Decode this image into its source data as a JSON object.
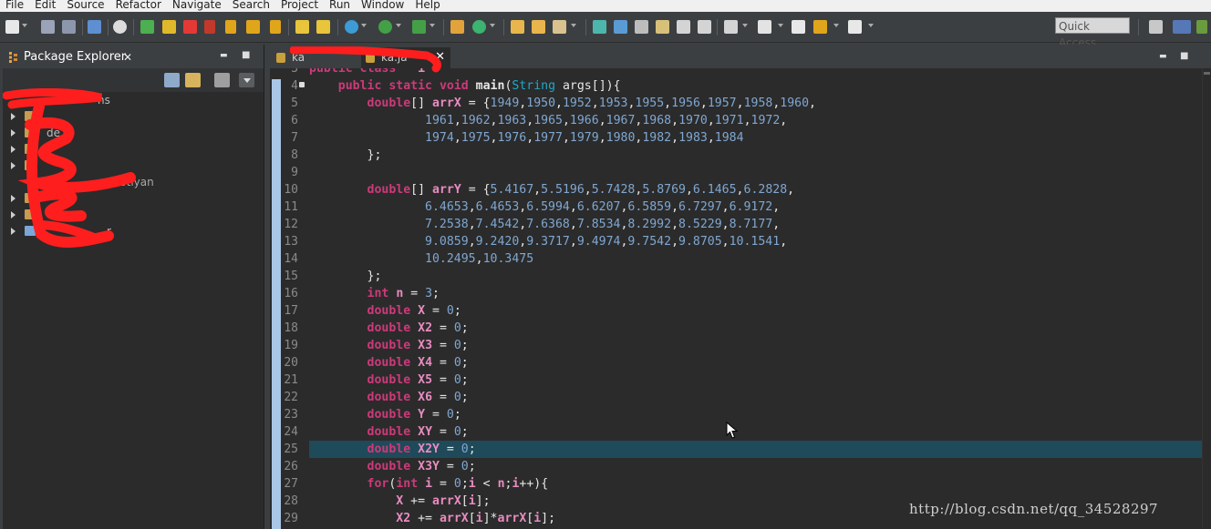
{
  "menu": [
    "File",
    "Edit",
    "Source",
    "Refactor",
    "Navigate",
    "Search",
    "Project",
    "Run",
    "Window",
    "Help"
  ],
  "toolbar": {
    "quick_access": "Quick Access"
  },
  "explorer": {
    "title": "Package Explorer",
    "close": "✕",
    "minimize": "▬",
    "maximize": "■",
    "items": [
      "ns",
      "",
      "de",
      "",
      "",
      "giaotiyan",
      "",
      "rs",
      "r"
    ]
  },
  "editor": {
    "tabs": [
      {
        "label": "ka"
      },
      {
        "label": "ka.ja"
      }
    ],
    "active_close": "✕",
    "lines": [
      {
        "n": "3",
        "text": "public class   i"
      },
      {
        "n": "4",
        "text": "    public static void main(String args[]){"
      },
      {
        "n": "5",
        "text": "        double[] arrX = {1949,1950,1952,1953,1955,1956,1957,1958,1960,"
      },
      {
        "n": "6",
        "text": "                1961,1962,1963,1965,1966,1967,1968,1970,1971,1972,"
      },
      {
        "n": "7",
        "text": "                1974,1975,1976,1977,1979,1980,1982,1983,1984"
      },
      {
        "n": "8",
        "text": "        };"
      },
      {
        "n": "9",
        "text": ""
      },
      {
        "n": "10",
        "text": "        double[] arrY = {5.4167,5.5196,5.7428,5.8769,6.1465,6.2828,"
      },
      {
        "n": "11",
        "text": "                6.4653,6.4653,6.5994,6.6207,6.5859,6.7297,6.9172,"
      },
      {
        "n": "12",
        "text": "                7.2538,7.4542,7.6368,7.8534,8.2992,8.5229,8.7177,"
      },
      {
        "n": "13",
        "text": "                9.0859,9.2420,9.3717,9.4974,9.7542,9.8705,10.1541,"
      },
      {
        "n": "14",
        "text": "                10.2495,10.3475"
      },
      {
        "n": "15",
        "text": "        };"
      },
      {
        "n": "16",
        "text": "        int n = 3;"
      },
      {
        "n": "17",
        "text": "        double X = 0;"
      },
      {
        "n": "18",
        "text": "        double X2 = 0;"
      },
      {
        "n": "19",
        "text": "        double X3 = 0;"
      },
      {
        "n": "20",
        "text": "        double X4 = 0;"
      },
      {
        "n": "21",
        "text": "        double X5 = 0;"
      },
      {
        "n": "22",
        "text": "        double X6 = 0;"
      },
      {
        "n": "23",
        "text": "        double Y = 0;"
      },
      {
        "n": "24",
        "text": "        double XY = 0;"
      },
      {
        "n": "25",
        "text": "        double X2Y = 0;"
      },
      {
        "n": "26",
        "text": "        double X3Y = 0;"
      },
      {
        "n": "27",
        "text": "        for(int i = 0;i < n;i++){"
      },
      {
        "n": "28",
        "text": "            X += arrX[i];"
      },
      {
        "n": "29",
        "text": "            X2 += arrX[i]*arrX[i];"
      }
    ],
    "highlighted_line": "25"
  },
  "watermark": "http://blog.csdn.net/qq_34528297",
  "colors": {
    "keyword": "#cc3a7a",
    "type": "#1ea9c9",
    "variable": "#e88cc0",
    "number": "#7fa7d2",
    "highlight": "#1f4a5a",
    "redaction": "#ff1e1e"
  }
}
